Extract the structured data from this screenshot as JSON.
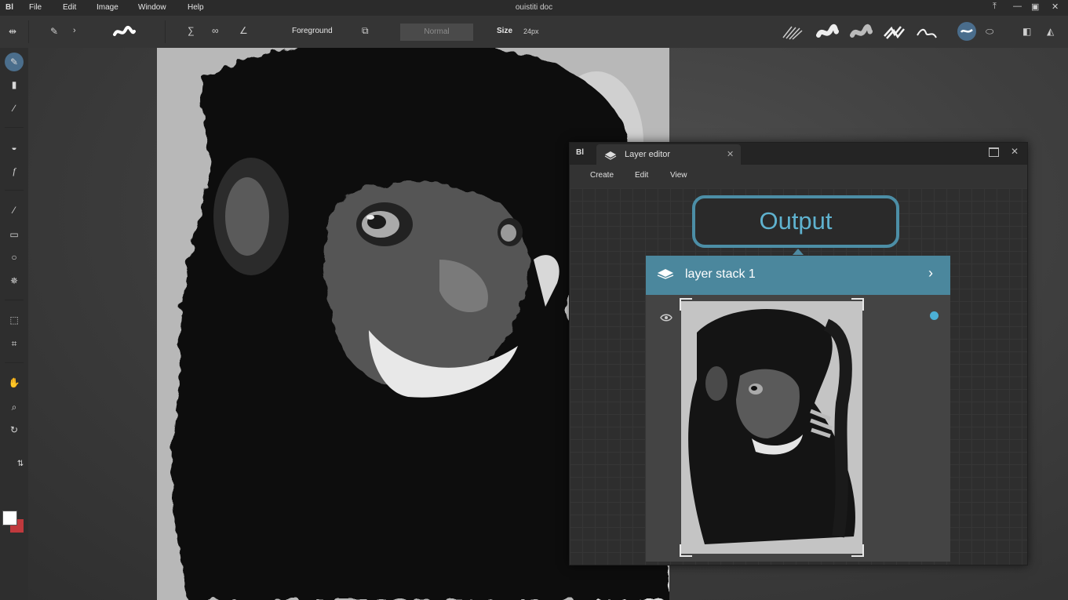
{
  "app": {
    "logo": "Bl",
    "title": "ouistiti doc",
    "menu": [
      "File",
      "Edit",
      "Image",
      "Window",
      "Help"
    ]
  },
  "toolbar": {
    "color_source_label": "Foreground",
    "blend_mode": "Normal",
    "size_label": "Size",
    "size_value": "24px"
  },
  "layer_editor": {
    "logo": "Bl",
    "tab_label": "Layer editor",
    "menu": [
      "Create",
      "Edit",
      "View"
    ],
    "output_label": "Output",
    "stack_label": "layer stack 1"
  },
  "colors": {
    "foreground": "#ffffff",
    "background": "#c0393d",
    "accent": "#4b879d",
    "output_text": "#5fb2cf",
    "visibility_dot": "#4cb0d6"
  },
  "icons": {
    "toolbox": [
      "brush-icon",
      "eraser-icon",
      "eyedropper-icon",
      "fill-icon",
      "function-icon",
      "line-icon",
      "rect-select-icon",
      "lasso-icon",
      "magic-select-icon",
      "transform-icon",
      "crop-icon",
      "hand-icon",
      "zoom-icon",
      "rotate-view-icon"
    ]
  }
}
